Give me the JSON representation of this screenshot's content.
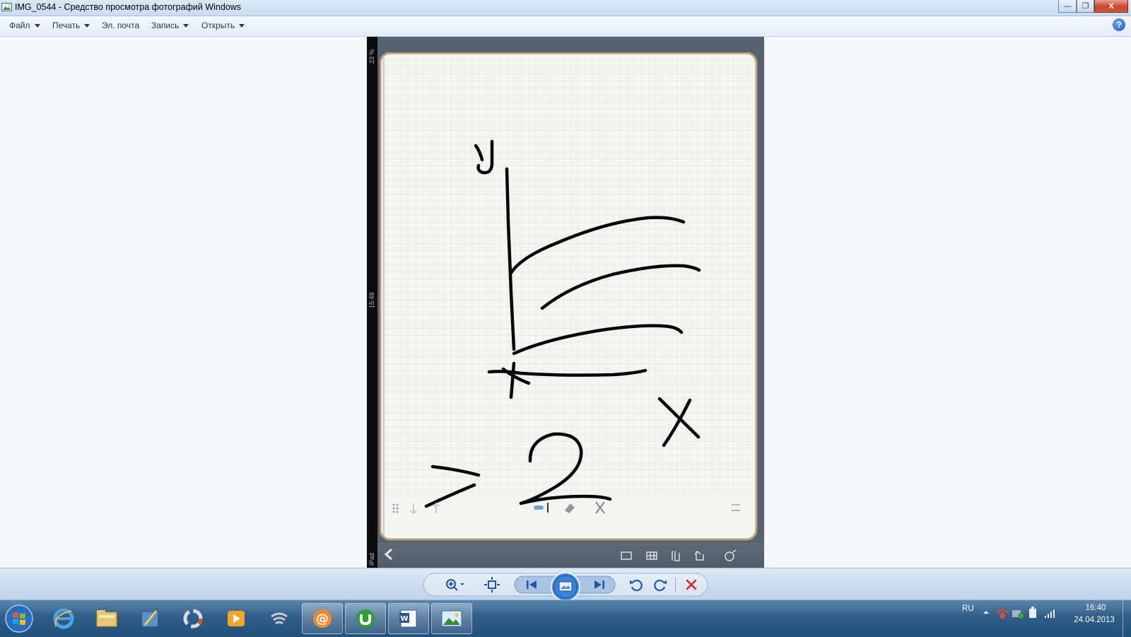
{
  "window": {
    "title": "IMG_0544 - Средство просмотра фотографий Windows",
    "minimize_label": "—",
    "restore_label": "❐",
    "close_label": "X"
  },
  "menu": {
    "items": [
      {
        "label": "Файл"
      },
      {
        "label": "Печать"
      },
      {
        "label": "Эл. почта"
      },
      {
        "label": "Запись"
      },
      {
        "label": "Открыть"
      }
    ],
    "help_label": "?"
  },
  "photo": {
    "status_battery": "23 %",
    "status_time": "15:49",
    "status_device": "iPad",
    "sketch_labels": {
      "y_axis": "y",
      "x_axis": "x",
      "inequality": "> 2"
    }
  },
  "taskbar": {
    "language": "RU",
    "time": "16:40",
    "date": "24.04.2013"
  },
  "colors": {
    "titlebar": "#c9dcf1",
    "taskbar": "#2f5c88",
    "close_red": "#c6472d",
    "viewer_bg": "#f5f9fd"
  }
}
